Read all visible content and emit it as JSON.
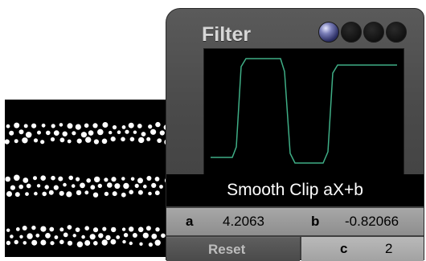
{
  "panel": {
    "title": "Filter",
    "function_name": "Smooth Clip aX+b",
    "params": {
      "a_label": "a",
      "a_value": "4.2063",
      "b_label": "b",
      "b_value": "-0.82066",
      "c_label": "c",
      "c_value": "2"
    },
    "reset_label": "Reset",
    "indicator_lights": [
      {
        "name": "light-1",
        "on": true
      },
      {
        "name": "light-2",
        "on": false
      },
      {
        "name": "light-3",
        "on": false
      },
      {
        "name": "light-4",
        "on": false
      }
    ],
    "curve_color": "#3fae86"
  }
}
